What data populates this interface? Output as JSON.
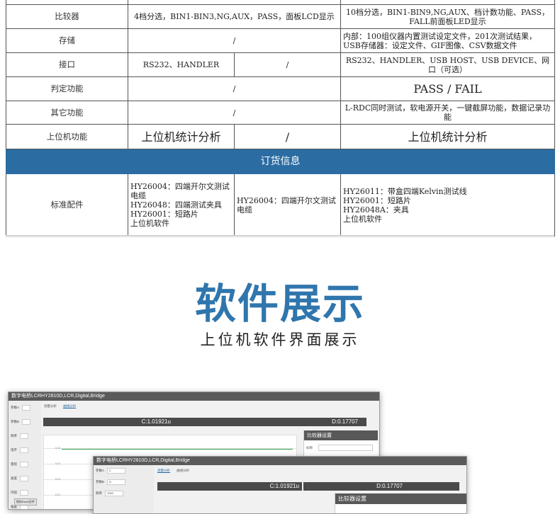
{
  "spec_table": {
    "rows": [
      {
        "label": "比较器",
        "c1": "4档分选，BIN1-BIN3,NG,AUX，PASS，面板LCD显示",
        "c3": "10档分选，BIN1-BIN9,NG,AUX、档计数功能、PASS，FALL前面板LED显示"
      },
      {
        "label": "存储",
        "c1": "/",
        "c3": "内部：100组仪器内置测试设定文件，201次测试结果，USB存储器：设定文件、GIF图像、CSV数据文件"
      },
      {
        "label": "接口",
        "c1": "RS232、HANDLER",
        "c2": "/",
        "c3": "RS232、HANDLER、USB HOST、USB DEVICE、网口（可选）"
      },
      {
        "label": "判定功能",
        "c1": "/",
        "c3": "PASS / FAIL"
      },
      {
        "label": "其它功能",
        "c1": "/",
        "c3": "L-RDC同时测试，软电源开关，一键截屏功能，数据记录功能"
      },
      {
        "label": "上位机功能",
        "c1": "上位机统计分析",
        "c2": "/",
        "c3": "上位机统计分析"
      }
    ],
    "banner": "订货信息",
    "accessories": {
      "label": "标准配件",
      "c1": [
        "HY26004：四端开尔文测试电缆",
        "HY26048：四端测试夹具",
        "HY26001：短路片",
        "上位机软件"
      ],
      "c2": [
        "HY26004：四端开尔文测试电缆"
      ],
      "c3": [
        "HY26011：带盒四端Kelvin测试线",
        "HY26001：短路片",
        "HY26048A：夹具",
        "上位机软件"
      ]
    }
  },
  "section": {
    "title": "软件展示",
    "subtitle": "上位机软件界面展示"
  },
  "software": {
    "window_title": "数字电桥LCRHY2810D,LCR,Digital,Bridge",
    "tab_measure": "测量分析",
    "tab_curve": "曲线分析",
    "display_c": "C:1.01921u",
    "display_d": "D:0.17707",
    "panel_title": "比较器设置",
    "panel_row": "标称",
    "sidebar": [
      "参数A",
      "参数B",
      "频率",
      "电平",
      "量程",
      "速度",
      "内阻",
      "偏置"
    ],
    "win2_sidebar": [
      {
        "label": "参数A",
        "value": "C"
      },
      {
        "label": "参数B",
        "value": "D"
      },
      {
        "label": "频率",
        "value": "1000"
      }
    ],
    "save_button": "保存Excel文件",
    "y_ticks": [
      "0.15",
      "0.14",
      "0.13",
      "0.12"
    ],
    "accent": "#2b6ca3"
  }
}
